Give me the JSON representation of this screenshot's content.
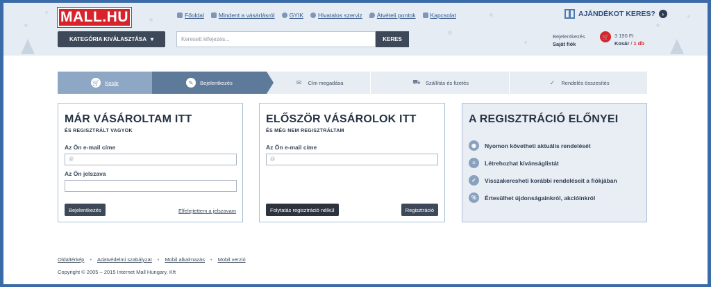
{
  "header": {
    "logo_text": "MALL.HU",
    "nav": [
      {
        "label": "Főoldal",
        "icon": "home-icon"
      },
      {
        "label": "Mindent a vásárlásról",
        "icon": "cart-icon"
      },
      {
        "label": "GYIK",
        "icon": "help-icon"
      },
      {
        "label": "Hivatalos szerviz",
        "icon": "gear-icon"
      },
      {
        "label": "Átvételi pontok",
        "icon": "map-pin-icon"
      },
      {
        "label": "Kapcsolat",
        "icon": "mail-icon"
      }
    ],
    "gift_label": "AJÁNDÉKOT KERES?",
    "category_button": "KATEGÓRIA KIVÁLASZTÁSA",
    "search_placeholder": "Keresett kifejezés...",
    "search_button": "KERES",
    "login_label": "Bejelentkezés",
    "account_label": "Saját fiók",
    "cart_total": "3 190 Ft",
    "cart_label": "Kosár",
    "cart_count": "1 db"
  },
  "steps": [
    {
      "label": "Kosár",
      "icon": "cart-icon"
    },
    {
      "label": "Bejelentkezés",
      "icon": "pencil-icon"
    },
    {
      "label": "Cím megadása",
      "icon": "envelope-icon"
    },
    {
      "label": "Szállítás és fizetés",
      "icon": "truck-icon"
    },
    {
      "label": "Rendelés összesítés",
      "icon": "check-icon"
    }
  ],
  "returning": {
    "title": "MÁR VÁSÁROLTAM ITT",
    "subtitle": "ÉS REGISZTRÁLT VAGYOK",
    "email_label": "Az Ön e-mail címe",
    "email_placeholder": "@",
    "password_label": "Az Ön jelszava",
    "login_button": "Bejelentkezés",
    "forgot_link": "Elfelejtettem a jelszavam"
  },
  "new_customer": {
    "title": "ELŐSZÖR VÁSÁROLOK ITT",
    "subtitle": "ÉS MÉG NEM REGISZTRÁLTAM",
    "email_label": "Az Ön e-mail címe",
    "email_placeholder": "@",
    "continue_button": "Folytatás regisztráció nélkül",
    "register_button": "Regisztráció"
  },
  "benefits": {
    "title": "A REGISZTRÁCIÓ ELŐNYEI",
    "items": [
      {
        "label": "Nyomon követheti aktuális rendelését",
        "icon": "eye-icon"
      },
      {
        "label": "Létrehozhat kívánságlistát",
        "icon": "list-icon"
      },
      {
        "label": "Visszakeresheti korábbi rendeléseit a fiókjában",
        "icon": "check-icon"
      },
      {
        "label": "Értesülhet újdonságainkról, akcióinkról",
        "icon": "percent-icon"
      }
    ]
  },
  "footer": {
    "links": [
      "Oldaltérkép",
      "Adatvédelmi szabályzat",
      "Mobil alkalmazás",
      "Mobil verzió"
    ],
    "copyright": "Copyright © 2005 – 2015 Internet Mall Hungary, Kft"
  }
}
